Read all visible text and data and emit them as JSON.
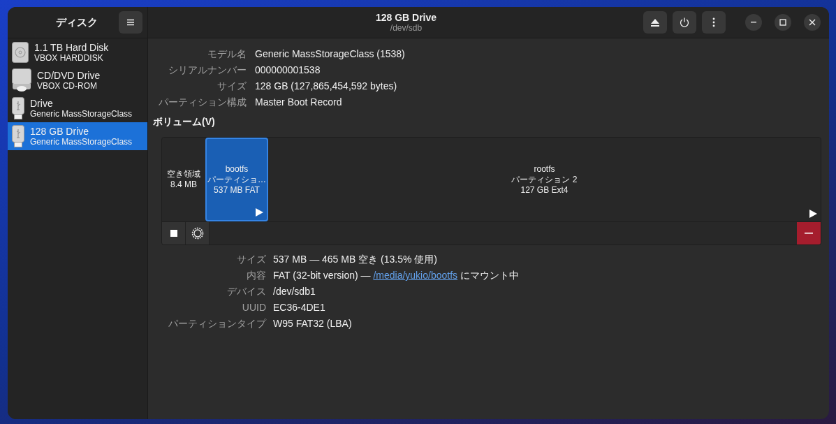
{
  "sidebar": {
    "title": "ディスク",
    "items": [
      {
        "kind": "hdd",
        "name": "1.1 TB Hard Disk",
        "sub": "VBOX HARDDISK",
        "selected": false
      },
      {
        "kind": "optical",
        "name": "CD/DVD Drive",
        "sub": "VBOX CD-ROM",
        "selected": false
      },
      {
        "kind": "usb",
        "name": "Drive",
        "sub": "Generic MassStorageClass",
        "selected": false
      },
      {
        "kind": "usb",
        "name": "128 GB Drive",
        "sub": "Generic MassStorageClass",
        "selected": true
      }
    ]
  },
  "header": {
    "title": "128 GB Drive",
    "subtitle": "/dev/sdb"
  },
  "drive_info": [
    {
      "label": "モデル名",
      "value": "Generic MassStorageClass (1538)"
    },
    {
      "label": "シリアルナンバー",
      "value": "000000001538"
    },
    {
      "label": "サイズ",
      "value": "128 GB (127,865,454,592 bytes)"
    },
    {
      "label": "パーティション構成",
      "value": "Master Boot Record"
    }
  ],
  "volumes": {
    "heading": "ボリューム(V)",
    "partitions": [
      {
        "kind": "free",
        "lines": [
          "空き領域",
          "8.4 MB"
        ],
        "selected": false
      },
      {
        "kind": "partition",
        "lines": [
          "bootfs",
          "パーティショ…",
          "537 MB FAT"
        ],
        "selected": true
      },
      {
        "kind": "partition",
        "lines": [
          "rootfs",
          "パーティション 2",
          "127 GB Ext4"
        ],
        "selected": false
      }
    ]
  },
  "volume_info": [
    {
      "label": "サイズ",
      "value": "537 MB — 465 MB 空き (13.5% 使用)"
    },
    {
      "label": "内容",
      "value": "FAT (32-bit version) — ",
      "link": "/media/yukio/bootfs",
      "after": " にマウント中"
    },
    {
      "label": "デバイス",
      "value": "/dev/sdb1"
    },
    {
      "label": "UUID",
      "value": "EC36-4DE1"
    },
    {
      "label": "パーティションタイプ",
      "value": "W95 FAT32 (LBA)"
    }
  ]
}
